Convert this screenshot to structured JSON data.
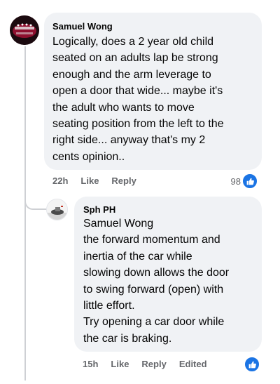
{
  "comments": [
    {
      "author": "Samuel Wong",
      "text": "Logically, does a 2 year old child\nseated on an adults lap be strong\nenough and the arm leverage to\nopen a door that wide... maybe it's\nthe adult who wants to move\nseating position from the left to the\nright side... anyway that's my 2\ncents opinion..",
      "time": "22h",
      "like_label": "Like",
      "reply_label": "Reply",
      "reaction_count": "98",
      "reaction_icon": "like-icon",
      "avatar_colors": [
        "#b3123a",
        "#1b0a0f"
      ]
    },
    {
      "author": "Sph PH",
      "text": "Samuel Wong\nthe forward momentum and\ninertia of the car while\nslowing down allows the door\nto swing forward (open) with\nlittle effort.\nTry opening a car door while\nthe car is braking.",
      "time": "15h",
      "like_label": "Like",
      "reply_label": "Reply",
      "edited_label": "Edited",
      "reaction_icon": "like-icon"
    }
  ],
  "colors": {
    "bubble": "#f0f2f5",
    "meta_text": "#65676b",
    "like_blue": "#1b74e4",
    "thread_line": "#ced0d4"
  }
}
